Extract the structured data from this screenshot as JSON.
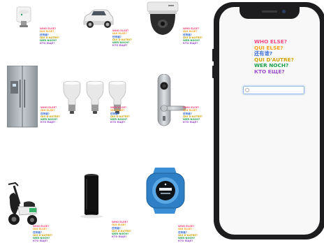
{
  "question_lines": [
    "WHO ELSE?",
    "QUI ELSE?",
    "还有谁?",
    "QUI D'AUTRE?",
    "WER NOCH?",
    "КТО ЕЩЕ?"
  ],
  "devices": [
    {
      "icon": "smart-thermostat-valve-icon"
    },
    {
      "icon": "suv-car-icon"
    },
    {
      "icon": "dome-security-camera-icon"
    },
    {
      "icon": "refrigerator-icon"
    },
    {
      "icon": "smart-light-bulbs-icon"
    },
    {
      "icon": "smart-door-lock-icon"
    },
    {
      "icon": "electric-scooter-icon"
    },
    {
      "icon": "smart-speaker-icon"
    },
    {
      "icon": "smartwatch-icon"
    }
  ],
  "phone": {
    "search_input_value": "",
    "search_placeholder": ""
  },
  "colors": {
    "line_colors": [
      "#f5487f",
      "#f7a21b",
      "#3a6fd8",
      "#d0a300",
      "#1aa04a",
      "#9b4fd0"
    ],
    "phone_frame": "#1d1d1f",
    "search_border": "#8fb8e6"
  }
}
